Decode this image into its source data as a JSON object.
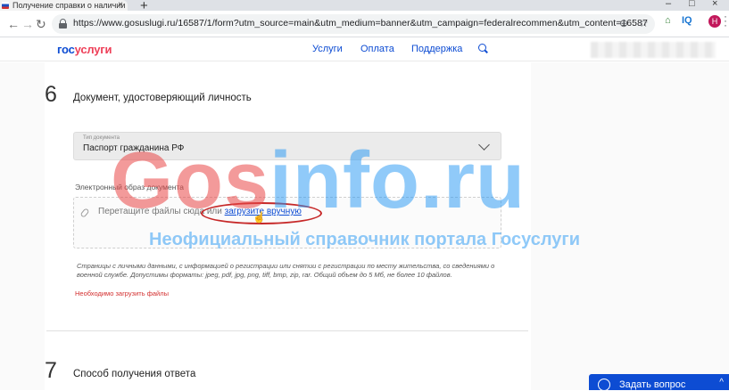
{
  "browser": {
    "tab_title": "Получение справки о наличии",
    "tab_close": "×",
    "new_tab": "+",
    "url": "https://www.gosuslugi.ru/16587/1/form?utm_source=main&utm_medium=banner&utm_campaign=federalrecommen&utm_content=16587",
    "nav": {
      "back": "←",
      "forward": "→",
      "reload": "↻"
    },
    "extensions": {
      "iq": "IQ",
      "avatar": "Н"
    },
    "window": {
      "min": "–",
      "max": "□",
      "close": "×"
    }
  },
  "site": {
    "logo_part1": "гос",
    "logo_part2": "услуги",
    "nav": [
      "Услуги",
      "Оплата",
      "Поддержка"
    ]
  },
  "step6": {
    "number": "6",
    "title": "Документ, удостоверяющий личность",
    "doc_type_label": "Тип документа",
    "doc_type_value": "Паспорт гражданина РФ",
    "upload_label": "Электронный образ документа",
    "drop_text": "Перетащите файлы сюда или",
    "drop_link": "загрузите вручную",
    "hint": "Страницы с личными данными, с информацией о регистрации или снятии с регистрации по месту жительства, со сведениями о военной службе. Допустимы форматы: jpeg, pdf, jpg, png, tiff, bmp, zip, rar. Общий объем до 5 Мб, не более 10 файлов.",
    "error": "Необходимо загрузить файлы"
  },
  "step7": {
    "number": "7",
    "title": "Способ получения ответа"
  },
  "watermark": {
    "part1": "Gos",
    "part2": "info.ru",
    "subtitle": "Неофициальный справочник портала Госуслуги"
  },
  "chat": {
    "label": "Задать вопрос",
    "arrow": "^"
  },
  "colors": {
    "brand_blue": "#0d4cd3",
    "brand_red": "#ee3f58",
    "error_red": "#d32f2f",
    "highlight_red": "#c62828"
  }
}
